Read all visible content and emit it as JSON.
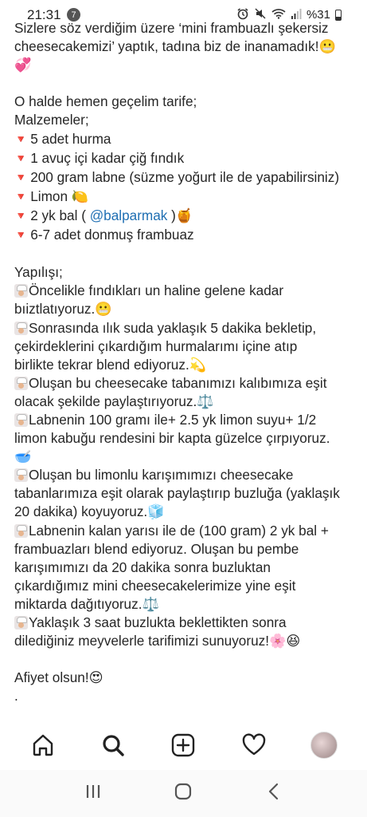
{
  "status_bar": {
    "time": "21:31",
    "notification_count": "7",
    "battery_text": "%31"
  },
  "post": {
    "lines": [
      {
        "text": "Sizlere söz verdiğim üzere ‘mini frambuazlı şekersiz"
      },
      {
        "text": "cheesecakemizi’ yaptık, tadına biz de inanamadık!😬"
      },
      {
        "text": "💞"
      },
      {
        "text": ""
      },
      {
        "text": "O halde hemen geçelim tarife;"
      },
      {
        "text": "Malzemeler;"
      },
      {
        "bullet": "🔻",
        "text": "5 adet hurma"
      },
      {
        "bullet": "🔻",
        "text": "1 avuç içi kadar çiğ fındık"
      },
      {
        "bullet": "🔻",
        "text": "200 gram labne (süzme yoğurt ile de yapabilirsiniz)"
      },
      {
        "bullet": "🔻",
        "text": "Limon 🍋"
      },
      {
        "bullet": "🔻",
        "text": "2 yk bal ( ",
        "mention": "@balparmak",
        "after": " )🍯"
      },
      {
        "bullet": "🔻",
        "text": "6-7 adet donmuş frambuaz"
      },
      {
        "text": ""
      },
      {
        "text": "Yapılışı;"
      },
      {
        "chef": true,
        "text": "Öncelikle fındıkları un haline gelene kadar"
      },
      {
        "text": "bıiztlatıyoruz.😬"
      },
      {
        "chef": true,
        "text": "Sonrasında ılık suda yaklaşık 5 dakika bekletip,"
      },
      {
        "text": "çekirdeklerini çıkardığım hurmalarımı içine atıp"
      },
      {
        "text": "birlikte tekrar blend ediyoruz.💫"
      },
      {
        "chef": true,
        "text": "Oluşan bu cheesecake tabanımızı kalıbımıza eşit"
      },
      {
        "text": "olacak şekilde paylaştırıyoruz.⚖️"
      },
      {
        "chef": true,
        "text": "Labnenin 100 gramı ile+ 2.5 yk limon suyu+ 1/2"
      },
      {
        "text": "limon kabuğu rendesini bir kapta güzelce çırpıyoruz."
      },
      {
        "text": "🥣"
      },
      {
        "chef": true,
        "text": "Oluşan bu limonlu karışımımızı cheesecake"
      },
      {
        "text": "tabanlarımıza eşit olarak paylaştırıp buzluğa (yaklaşık"
      },
      {
        "text": "20 dakika) koyuyoruz.🧊"
      },
      {
        "chef": true,
        "text": "Labnenin kalan yarısı ile de (100 gram) 2 yk bal +"
      },
      {
        "text": "frambuazları blend ediyoruz. Oluşan bu pembe"
      },
      {
        "text": "karışımımızı da 20 dakika sonra buzluktan"
      },
      {
        "text": "çıkardığımız mini cheesecakelerimize yine eşit"
      },
      {
        "text": "miktarda dağıtıyoruz.⚖️"
      },
      {
        "chef": true,
        "text": "Yaklaşık 3 saat buzlukta beklettikten sonra"
      },
      {
        "text": "dilediğiniz meyvelerle tarifimizi sunuyoruz!🌸😆"
      },
      {
        "text": ""
      },
      {
        "text": "Afiyet olsun!😍"
      },
      {
        "text": "."
      }
    ]
  },
  "bottom_nav": {
    "items": [
      "home-icon",
      "search-icon",
      "add-post-icon",
      "activity-heart-icon",
      "profile-avatar"
    ]
  },
  "system_nav": {
    "items": [
      "recent-apps-icon",
      "home-button-icon",
      "back-icon"
    ]
  },
  "colors": {
    "text": "#262626",
    "mention": "#1f6fb3",
    "bullet": "#d3243a"
  }
}
